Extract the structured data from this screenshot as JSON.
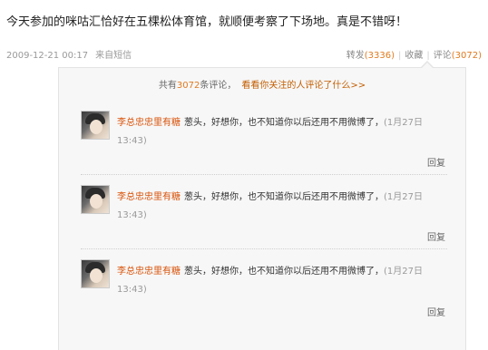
{
  "post": {
    "text": "今天参加的咪咕汇恰好在五棵松体育馆，就顺便考察了下场地。真是不错呀！",
    "time": "2009-12-21 00:17",
    "source": "来自短信"
  },
  "actions": {
    "repost_label": "转发",
    "repost_count": "(3336)",
    "favorite_label": "收藏",
    "comment_label": "评论",
    "comment_count": "(3072)",
    "separator": "|"
  },
  "comments_summary": {
    "prefix": "共有",
    "count": "3072",
    "suffix": "条评论，",
    "friends_link": "看看你关注的人评论了什么>>"
  },
  "comments": [
    {
      "user": "李总忠忠里有糖",
      "text": "葱头，好想你，也不知道你以后还用不用微博了，",
      "time": "(1月27日 13:43)",
      "reply_label": "回复"
    },
    {
      "user": "李总忠忠里有糖",
      "text": "葱头，好想你，也不知道你以后还用不用微博了，",
      "time": "(1月27日 13:43)",
      "reply_label": "回复"
    },
    {
      "user": "李总忠忠里有糖",
      "text": "葱头，好想你，也不知道你以后还用不用微博了，",
      "time": "(1月27日 13:43)",
      "reply_label": "回复"
    }
  ],
  "colors": {
    "username": "#d9530a",
    "count": "#e07a1f",
    "panel_bg": "#f7f7f7"
  }
}
